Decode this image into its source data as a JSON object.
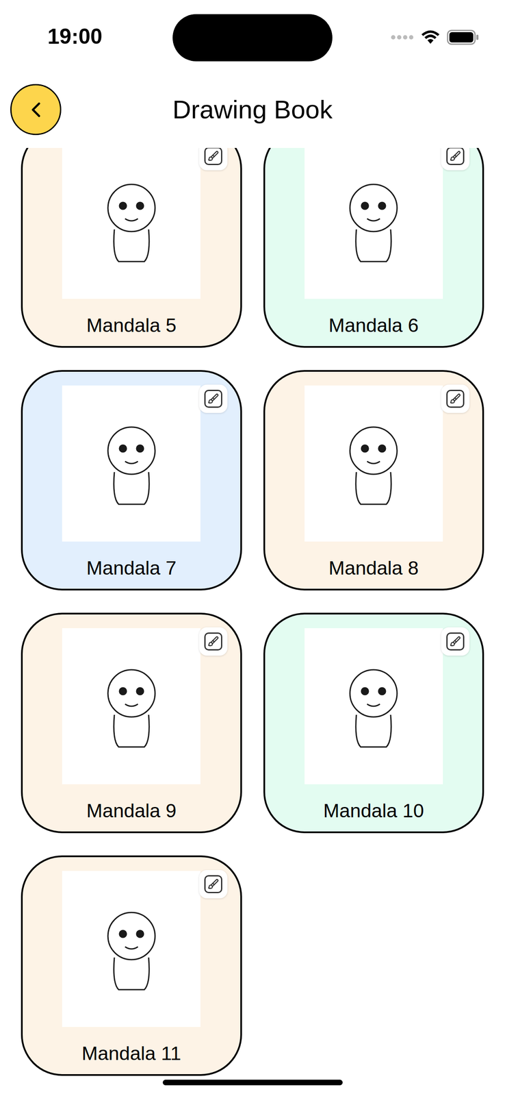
{
  "status_bar": {
    "time": "19:00"
  },
  "header": {
    "title": "Drawing Book"
  },
  "cards": [
    {
      "label": "Mandala 5",
      "color": "#fdf3e6"
    },
    {
      "label": "Mandala 6",
      "color": "#e3fcf1"
    },
    {
      "label": "Mandala 7",
      "color": "#e2effd"
    },
    {
      "label": "Mandala 8",
      "color": "#fdf3e6"
    },
    {
      "label": "Mandala 9",
      "color": "#fdf3e6"
    },
    {
      "label": "Mandala 10",
      "color": "#e3fcf1"
    },
    {
      "label": "Mandala 11",
      "color": "#fdf3e6"
    }
  ]
}
